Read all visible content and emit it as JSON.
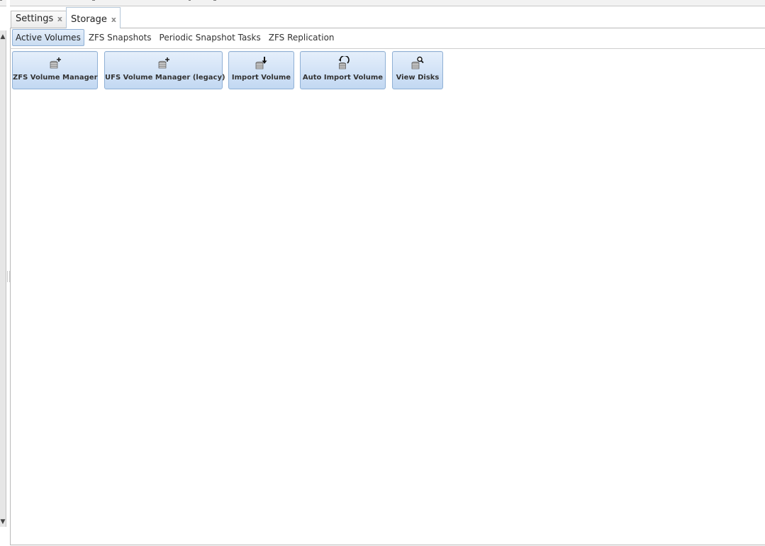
{
  "tabs": [
    {
      "label": "Settings",
      "close": "x"
    },
    {
      "label": "Storage",
      "close": "x"
    }
  ],
  "subtabs": [
    {
      "label": "Active Volumes"
    },
    {
      "label": "ZFS Snapshots"
    },
    {
      "label": "Periodic Snapshot Tasks"
    },
    {
      "label": "ZFS Replication"
    }
  ],
  "toolbar": [
    {
      "label": "ZFS Volume Manager",
      "icon": "disk-add-icon"
    },
    {
      "label": "UFS Volume Manager (legacy)",
      "icon": "disk-add-icon"
    },
    {
      "label": "Import Volume",
      "icon": "disk-import-icon"
    },
    {
      "label": "Auto Import Volume",
      "icon": "disk-auto-import-icon"
    },
    {
      "label": "View Disks",
      "icon": "disk-search-icon"
    }
  ],
  "colors": {
    "accent_border": "#8fb0d5",
    "button_bg": "#c2d8f2"
  }
}
